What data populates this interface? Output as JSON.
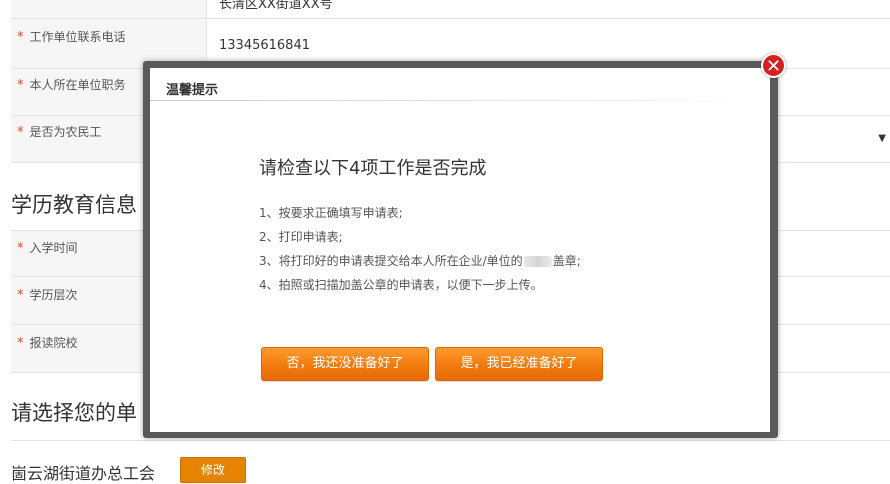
{
  "form": {
    "row_top_value": "长清区XX街道XX号",
    "employer_phone_label": "工作单位联系电话",
    "employer_phone_value": "13345616841",
    "position_label": "本人所在单位职务",
    "migrant_label": "是否为农民工",
    "select_arrow": "▼",
    "required_star": "*",
    "education_section_title": "学历教育信息",
    "enroll_time_label": "入学时间",
    "edu_level_label": "学历层次",
    "school_label": "报读院校",
    "unit_section_title": "请选择您的单",
    "union_name": "崮云湖街道办总工会",
    "edit_label": "修改"
  },
  "modal": {
    "title": "温馨提示",
    "close_symbol": "✕",
    "heading": "请检查以下4项工作是否完成",
    "steps": [
      "1、按要求正确填写申请表;",
      "2、打印申请表;",
      "3、将打印好的申请表提交给本人所在企业/单位的",
      "4、拍照或扫描加盖公章的申请表，以便下一步上传。"
    ],
    "step3_suffix": "盖章;",
    "no_button": "否，我还没准备好了",
    "yes_button": "是，我已经准备好了"
  },
  "colors": {
    "accent_orange": "#f27b10",
    "required_red": "#e8491d",
    "close_red": "#d42020"
  }
}
